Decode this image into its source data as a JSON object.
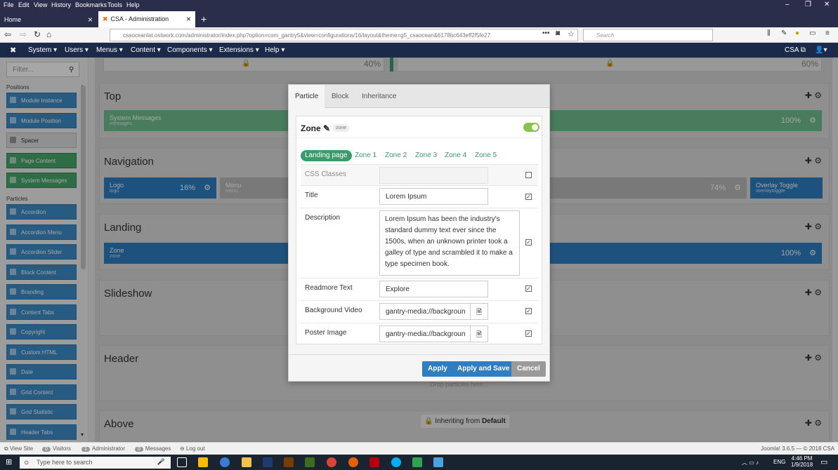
{
  "browser": {
    "menu": [
      "File",
      "Edit",
      "View",
      "History",
      "Bookmarks",
      "Tools",
      "Help"
    ],
    "tabs": [
      {
        "label": "Home"
      },
      {
        "label": "CSA - Administration"
      }
    ],
    "url": "csaoceanlat.ostwork.com/administrator/index.php?option=com_gantry5&view=configurations/16/layout&theme=g5_csaocean&6178bc643eff2f5fe27",
    "search_placeholder": "Search"
  },
  "joomla": {
    "menu": [
      "System",
      "Users",
      "Menus",
      "Content",
      "Components",
      "Extensions",
      "Help"
    ],
    "site": "CSA"
  },
  "sidebar": {
    "filter_placeholder": "Filter...",
    "positions_heading": "Positions",
    "positions": [
      {
        "label": "Module Instance"
      },
      {
        "label": "Module Position"
      },
      {
        "label": "Spacer"
      },
      {
        "label": "Page Content"
      },
      {
        "label": "System Messages"
      }
    ],
    "particles_heading": "Particles",
    "particles": [
      {
        "label": "Accordion"
      },
      {
        "label": "Accordion Menu"
      },
      {
        "label": "Accordion Slider"
      },
      {
        "label": "Block Content"
      },
      {
        "label": "Branding"
      },
      {
        "label": "Content Tabs"
      },
      {
        "label": "Copyright"
      },
      {
        "label": "Custom HTML"
      },
      {
        "label": "Date"
      },
      {
        "label": "Grid Content"
      },
      {
        "label": "Grid Statistic"
      },
      {
        "label": "Header Tabs"
      }
    ]
  },
  "layout": {
    "top_pct_left": "40%",
    "top_pct_right": "60%",
    "sections": [
      {
        "title": "Top"
      },
      {
        "title": "Navigation"
      },
      {
        "title": "Landing"
      },
      {
        "title": "Slideshow"
      },
      {
        "title": "Header"
      },
      {
        "title": "Above"
      }
    ],
    "system_messages": {
      "label": "System Messages",
      "sub": "messages",
      "pct": "100%"
    },
    "logo": {
      "label": "Logo",
      "sub": "logo",
      "pct": "16%"
    },
    "menu": {
      "label": "Menu",
      "sub": "menu"
    },
    "nav_pct": "74%",
    "overlay_toggle": {
      "label": "Overlay Toggle",
      "sub": "overlaytoggle"
    },
    "zone": {
      "label": "Zone",
      "sub": "zone",
      "pct": "100%"
    },
    "drop_hint": "Drop particles here...",
    "inheriting_prefix": "Inheriting from",
    "inheriting_from": "Default"
  },
  "modal": {
    "tabs": [
      "Particle",
      "Block",
      "Inheritance"
    ],
    "title": "Zone",
    "tag": "zone",
    "zone_tabs": [
      "Landing page",
      "Zone 1",
      "Zone 2",
      "Zone 3",
      "Zone 4",
      "Zone 5"
    ],
    "fields": {
      "css_classes": {
        "label": "CSS Classes",
        "value": ""
      },
      "title": {
        "label": "Title",
        "value": "Lorem Ipsum"
      },
      "description": {
        "label": "Description",
        "value": "Lorem Ipsum has been the industry's standard dummy text ever since the 1500s, when an unknown printer took a galley of type and scrambled it to make a type specimen book."
      },
      "readmore": {
        "label": "Readmore Text",
        "value": "Explore"
      },
      "background_video": {
        "label": "Background Video",
        "value": "gantry-media://backgroun"
      },
      "poster_image": {
        "label": "Poster Image",
        "value": "gantry-media://backgroun"
      }
    },
    "buttons": {
      "apply": "Apply",
      "apply_save": "Apply and Save",
      "cancel": "Cancel"
    }
  },
  "status": {
    "view_site": "View Site",
    "visitors_count": "0",
    "visitors": "Visitors",
    "admin_count": "1",
    "admin": "Administrator",
    "messages_count": "0",
    "messages": "Messages",
    "logout": "Log out",
    "version": "Joomla! 3.6.5 — © 2018 CSA"
  },
  "taskbar": {
    "search_placeholder": "Type here to search",
    "lang": "ENG",
    "time": "4:46 PM",
    "date": "1/9/2018"
  },
  "colors": {
    "blue": "#3c8cc8",
    "green": "#48a86c",
    "accent_green": "#3a9b6b",
    "apply_blue": "#2f7ec2",
    "cancel_grey": "#9a9a9a"
  }
}
